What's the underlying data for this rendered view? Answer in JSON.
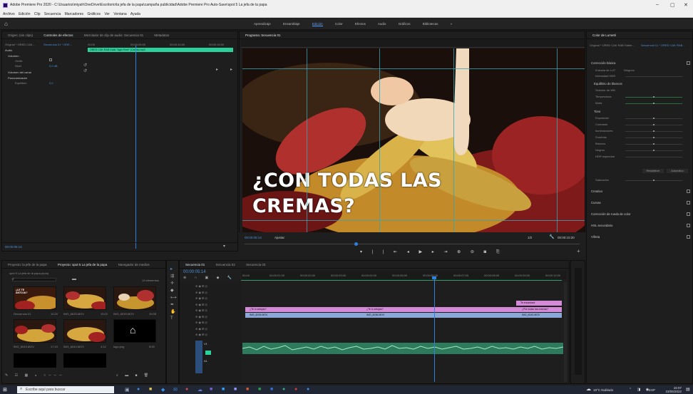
{
  "window": {
    "title": "Adobe Premiere Pro 2020 - C:\\Usuarios\\miyah\\OneDrive\\Escritorio\\la jefa de la papa\\campaña publicidad\\Adobe Premiere Pro Auto-Save\\spot 5 La jefa de la papa",
    "controls": [
      "–",
      "▢",
      "✕"
    ]
  },
  "menu": [
    "Archivo",
    "Edición",
    "Clip",
    "Secuencia",
    "Marcadores",
    "Gráficos",
    "Ver",
    "Ventana",
    "Ayuda"
  ],
  "workspaces": [
    "Aprendizaje",
    "Ensamblaje",
    "Edición",
    "Color",
    "Efectos",
    "Audio",
    "Gráficos",
    "Bibliotecas",
    "»"
  ],
  "effect_controls": {
    "tabs": [
      "Origen: (sin clips)",
      "Controles de efectos",
      "Mezclador de clip de audio: Secuencia 01",
      "Metadatos"
    ],
    "source": "Original * ORED CAK...",
    "sequence": "Secuencia 01 * ORE...",
    "timecodes": [
      "00:00",
      "00:00:05:00",
      "00:00:10:00",
      "00:00:15:00"
    ],
    "clip_bar": "ORED CAK RAB Gallo \"Agin Reel\" (Canda).mp3",
    "section_audio": "Audio",
    "fx_volume": "Volumen",
    "omit": "Omitir",
    "level": "Nivel",
    "level_value": "0,0 dB",
    "fx_channel": "Volumen del canal",
    "fx_pan": "Panoramizador",
    "balance": "Equilibrio",
    "balance_value": "0,0",
    "timecode": "00:00:05:14"
  },
  "program": {
    "title": "Programa: Secuencia 01",
    "caption_line1": "¿CON TODAS LAS",
    "caption_line2": "CREMAS?",
    "timecode": "00:00:05:14",
    "fit": "Ajustar",
    "quality": "1/2",
    "duration": "00:00:10:20"
  },
  "lumetri": {
    "tab": "Color de Lumetri",
    "source": "Original * ORED CAK RAB Galler...",
    "sequence": "Secuencia 01 * ORED CAK RAB...",
    "sections": [
      "Corrección básica",
      "Creativo",
      "Curvas",
      "Corrección de rueda de color",
      "HSL secundario",
      "Viñeta"
    ],
    "lut_label": "Entrada de LUT",
    "lut_value": "Ninguno",
    "intensity": "Intensidad HDR",
    "white_balance": "Equilibrio de blancos",
    "wb_selector": "Selector de WB",
    "temperature": "Temperatura",
    "tint": "Matiz",
    "tone": "Tono",
    "tone_rows": [
      "Exposición",
      "Contraste",
      "Iluminaciones",
      "Sombras",
      "Blancos",
      "Negros",
      "HDR especular"
    ],
    "reset": "Restablecer",
    "auto": "Automático",
    "saturation": "Saturación"
  },
  "project": {
    "tabs": [
      "Proyecto: la jefe de la papa",
      "Proyecto: spot 5 La jefa de la papa",
      "Navegador de medios"
    ],
    "bin": "spot 5 La jefa de la papa.prproj",
    "count": "13 elementos",
    "items": [
      {
        "name": "Secuencia 01",
        "dur": "10:20",
        "overlay": "¿LE TE ANTOJA?"
      },
      {
        "name": "IMG_6633.MOV",
        "dur": "10:02",
        "overlay": ""
      },
      {
        "name": "IMG_6039.MOV",
        "dur": "15:08",
        "overlay": ""
      },
      {
        "name": "IMG_6043.MOV",
        "dur": "17:10",
        "overlay": ""
      },
      {
        "name": "IMG_6044.MOV",
        "dur": "4:12",
        "overlay": ""
      },
      {
        "name": "logo.png",
        "dur": "5:00",
        "overlay": ""
      }
    ]
  },
  "sequence": {
    "tabs": [
      "Secuencia 01",
      "Secuencia 02",
      "Secuencia 03"
    ],
    "timecode": "00:00:05:14",
    "ruler": [
      "00:00",
      "00:00:01:00",
      "00:00:02:00",
      "00:00:03:00",
      "00:00:04:00",
      "00:00:05:00",
      "00:00:06:00",
      "00:00:07:00",
      "00:00:08:00",
      "00:00:09:00",
      "00:00:10:00"
    ],
    "tracks": [
      "V3",
      "V2",
      "V1",
      "A1",
      "A2",
      "A3"
    ],
    "clips_pink_top": [
      "Te encantará"
    ],
    "clips_pink": [
      "¿Te lo antojas?",
      "¿Te lo antojas?",
      "¿Por todas las cremas?"
    ],
    "clips_blue": [
      "IMG_6034.MOV",
      "IMG_6036.MOV",
      "IMG_6042.MOV"
    ]
  },
  "taskbar": {
    "search": "Escribe aquí para buscar",
    "weather": "19°C Nublado",
    "lang": "ESP",
    "time": "15:07",
    "date": "23/05/2022"
  },
  "colors": {
    "accent": "#4d8fd8",
    "playhead": "#2f7fe0",
    "clip_pink": "#d58ad8",
    "clip_blue": "#8aa7d8",
    "audio_green": "#2e7a5c",
    "guide": "#36a3b5"
  }
}
